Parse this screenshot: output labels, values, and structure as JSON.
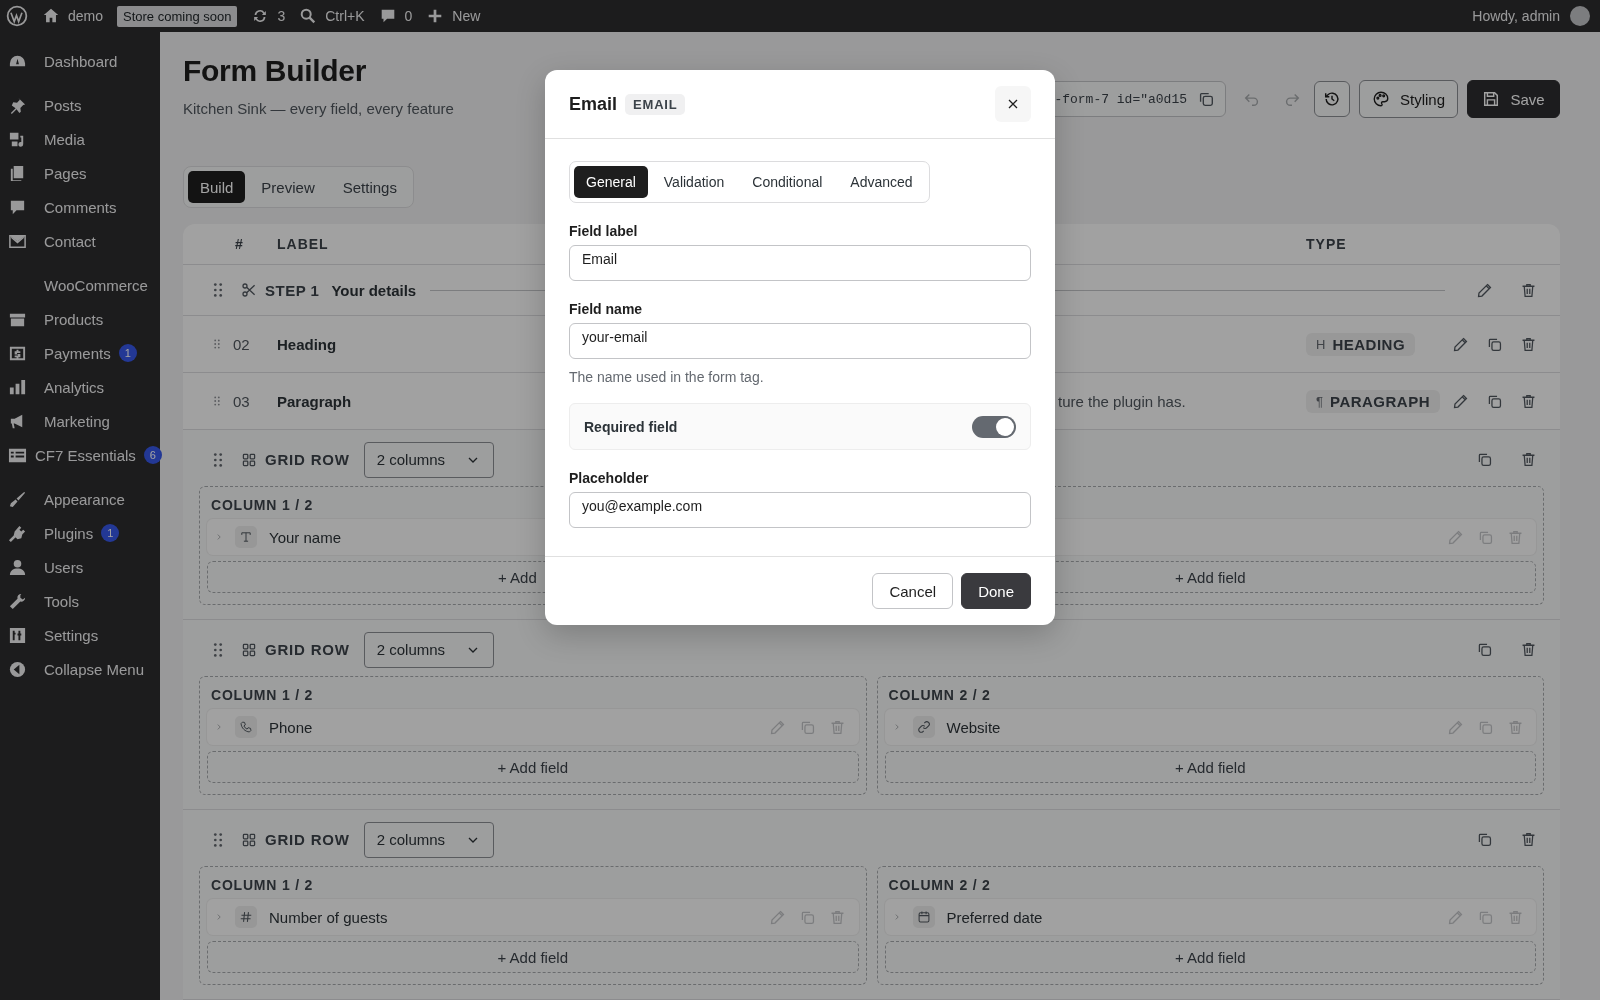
{
  "top_bar": {
    "items": [
      {
        "kind": "wp"
      },
      {
        "kind": "home",
        "label": "demo"
      },
      {
        "kind": "badge",
        "label": "Store coming soon"
      },
      {
        "kind": "updates",
        "label": "3"
      },
      {
        "kind": "search",
        "label": "Ctrl+K"
      },
      {
        "kind": "comments",
        "label": "0"
      },
      {
        "kind": "new",
        "label": "New"
      }
    ],
    "greeting": "Howdy, admin"
  },
  "sidebar": {
    "groups": [
      {
        "items": [
          {
            "kind": "dashboard",
            "label": "Dashboard"
          }
        ]
      },
      {
        "items": [
          {
            "kind": "pin",
            "label": "Posts"
          },
          {
            "kind": "media",
            "label": "Media"
          },
          {
            "kind": "pages",
            "label": "Pages"
          },
          {
            "kind": "comment",
            "label": "Comments"
          },
          {
            "kind": "mail",
            "label": "Contact"
          }
        ]
      },
      {
        "items": [
          {
            "kind": "none",
            "label": "WooCommerce"
          },
          {
            "kind": "box",
            "label": "Products"
          },
          {
            "kind": "dollar",
            "label": "Payments",
            "badge": "1"
          },
          {
            "kind": "bars",
            "label": "Analytics"
          },
          {
            "kind": "megaphone",
            "label": "Marketing"
          },
          {
            "kind": "list",
            "label": "CF7 Essentials",
            "badge": "6"
          }
        ]
      },
      {
        "items": [
          {
            "kind": "brush",
            "label": "Appearance"
          },
          {
            "kind": "plug",
            "label": "Plugins",
            "badge": "1"
          },
          {
            "kind": "user",
            "label": "Users"
          },
          {
            "kind": "wrench",
            "label": "Tools"
          },
          {
            "kind": "sliders",
            "label": "Settings"
          },
          {
            "kind": "collapse",
            "label": "Collapse Menu"
          }
        ]
      }
    ]
  },
  "page": {
    "title": "Form Builder",
    "subtitle": "Kitchen Sink — every field, every feature",
    "shortcode": "-form-7 id=\"a0d15",
    "tools": [
      {
        "kind": "undo",
        "disabled": true
      },
      {
        "kind": "redo",
        "disabled": true
      },
      {
        "kind": "history",
        "disabled": false
      }
    ],
    "styling_button": "Styling",
    "save_button": "Save",
    "tabs": [
      {
        "label": "Build",
        "selected": true
      },
      {
        "label": "Preview",
        "selected": false
      },
      {
        "label": "Settings",
        "selected": false
      }
    ]
  },
  "table": {
    "columns": [
      {
        "kind": "num",
        "label": "#"
      },
      {
        "kind": "label",
        "label": "LABEL"
      },
      {
        "kind": "type",
        "label": "TYPE"
      }
    ],
    "rows": [
      {
        "kind": "step",
        "step": "STEP 1",
        "title": "Your details"
      },
      {
        "kind": "field",
        "num": "02",
        "label": "Heading",
        "type_icon": "H",
        "type": "HEADING"
      },
      {
        "kind": "field",
        "num": "03",
        "label": "Paragraph",
        "preview": "ture the plugin has.",
        "type_icon": "¶",
        "type": "PARAGRAPH"
      },
      {
        "kind": "grid",
        "title": "GRID ROW",
        "select": "2 columns",
        "columns": [
          {
            "title": "COLUMN 1 / 2",
            "fields": [
              {
                "kind": "text",
                "label": "Your name"
              }
            ],
            "add": "+ Add"
          },
          {
            "fields": [
              {
                "kind": "covered"
              }
            ],
            "add": "+ Add field"
          }
        ]
      },
      {
        "kind": "grid",
        "title": "GRID ROW",
        "select": "2 columns",
        "columns": [
          {
            "title": "COLUMN 1 / 2",
            "fields": [
              {
                "kind": "phone",
                "label": "Phone"
              }
            ],
            "add": "+ Add field"
          },
          {
            "title": "COLUMN 2 / 2",
            "fields": [
              {
                "kind": "link",
                "label": "Website"
              }
            ],
            "add": "+ Add field"
          }
        ]
      },
      {
        "kind": "grid",
        "title": "GRID ROW",
        "select": "2 columns",
        "columns": [
          {
            "title": "COLUMN 1 / 2",
            "fields": [
              {
                "kind": "hash",
                "label": "Number of guests"
              }
            ],
            "add": "+ Add field"
          },
          {
            "title": "COLUMN 2 / 2",
            "fields": [
              {
                "kind": "calendar",
                "label": "Preferred date"
              }
            ],
            "add": "+ Add field"
          }
        ]
      }
    ]
  },
  "modal": {
    "title": "Email",
    "badge": "EMAIL",
    "tabs": [
      {
        "label": "General",
        "selected": true
      },
      {
        "label": "Validation",
        "selected": false
      },
      {
        "label": "Conditional",
        "selected": false
      },
      {
        "label": "Advanced",
        "selected": false
      }
    ],
    "fields": [
      {
        "kind": "text",
        "label": "Field label",
        "value": "Email"
      },
      {
        "kind": "text",
        "label": "Field name",
        "value": "your-email",
        "help": "The name used in the form tag."
      },
      {
        "kind": "toggle",
        "label": "Required field",
        "on": true
      },
      {
        "kind": "text",
        "label": "Placeholder",
        "value": "you@example.com"
      }
    ],
    "buttons": [
      {
        "kind": "secondary",
        "label": "Cancel"
      },
      {
        "kind": "primary",
        "label": "Done"
      }
    ]
  }
}
